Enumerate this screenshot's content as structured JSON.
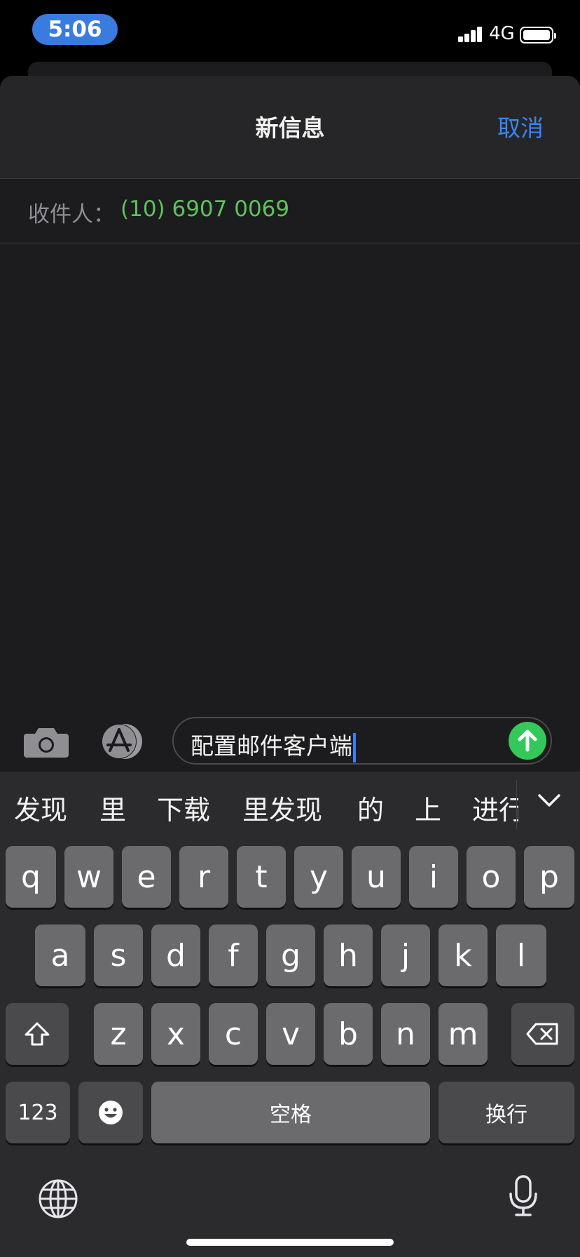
{
  "status_bar": {
    "time": "5:06",
    "network": "4G",
    "icons": [
      "signal-icon",
      "battery-icon"
    ]
  },
  "nav": {
    "title": "新信息",
    "cancel_label": "取消"
  },
  "recipient": {
    "label": "收件人：",
    "value": "(10) 6907 0069"
  },
  "compose": {
    "message_text": "配置邮件客户端",
    "icons": [
      "camera-icon",
      "app-store-icon",
      "send-arrow-icon"
    ]
  },
  "keyboard": {
    "candidates": [
      "发现",
      "里",
      "下载",
      "里发现",
      "的",
      "上",
      "进行"
    ],
    "rows": [
      [
        "q",
        "w",
        "e",
        "r",
        "t",
        "y",
        "u",
        "i",
        "o",
        "p"
      ],
      [
        "a",
        "s",
        "d",
        "f",
        "g",
        "h",
        "j",
        "k",
        "l"
      ],
      [
        "z",
        "x",
        "c",
        "v",
        "b",
        "n",
        "m"
      ]
    ],
    "numbers_label": "123",
    "space_label": "空格",
    "return_label": "换行",
    "icons": [
      "shift-icon",
      "delete-icon",
      "emoji-icon",
      "globe-icon",
      "microphone-icon",
      "chevron-down-icon"
    ]
  },
  "colors": {
    "accent_blue": "#3a86f0",
    "recipient_green": "#5ec25a",
    "send_green": "#34c759",
    "time_pill": "#3a7be0"
  }
}
